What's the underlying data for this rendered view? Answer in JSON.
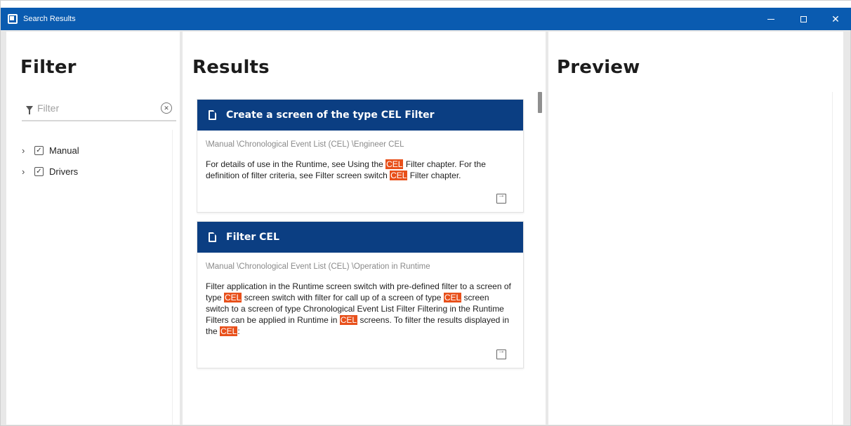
{
  "window": {
    "title": "Search Results",
    "controls": [
      "minimize",
      "maximize",
      "close"
    ],
    "accent_color": "#0a5bb0"
  },
  "filter": {
    "heading": "Filter",
    "placeholder": "Filter",
    "tree": [
      {
        "label": "Manual",
        "checked": true,
        "expanded": false
      },
      {
        "label": "Drivers",
        "checked": true,
        "expanded": false
      }
    ]
  },
  "results": {
    "heading": "Results",
    "highlight_color": "#e8501b",
    "header_color": "#0b3e82",
    "items": [
      {
        "title": "Create a screen of the type CEL Filter",
        "path": "\\Manual \\Chronological Event List (CEL) \\Engineer CEL",
        "snippet_parts": [
          {
            "text": "For details of use in the Runtime, see Using the ",
            "hl": false
          },
          {
            "text": "CEL",
            "hl": true
          },
          {
            "text": " Filter chapter. For the definition of filter criteria, see Filter screen switch ",
            "hl": false
          },
          {
            "text": "CEL",
            "hl": true
          },
          {
            "text": " Filter chapter.",
            "hl": false
          }
        ]
      },
      {
        "title": "Filter CEL",
        "path": "\\Manual \\Chronological Event List (CEL) \\Operation in Runtime",
        "snippet_parts": [
          {
            "text": "Filter application in the Runtime screen switch with pre-defined filter to a screen of type ",
            "hl": false
          },
          {
            "text": "CEL",
            "hl": true
          },
          {
            "text": " screen switch with filter for call up of a screen of type ",
            "hl": false
          },
          {
            "text": "CEL",
            "hl": true
          },
          {
            "text": " screen switch to a screen of type Chronological Event List Filter Filtering in the Runtime Filters can be applied in Runtime in ",
            "hl": false
          },
          {
            "text": "CEL",
            "hl": true
          },
          {
            "text": " screens. To filter the results displayed in the ",
            "hl": false
          },
          {
            "text": "CEL",
            "hl": true
          },
          {
            "text": ":",
            "hl": false
          }
        ]
      }
    ]
  },
  "preview": {
    "heading": "Preview"
  }
}
